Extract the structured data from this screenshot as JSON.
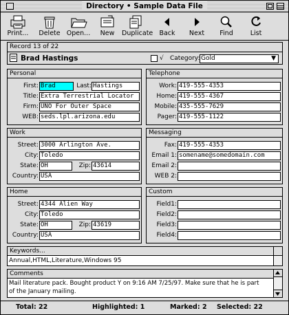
{
  "window": {
    "title": "Directory • Sample Data File"
  },
  "toolbar": [
    {
      "label": "Print...",
      "icon": "printer-icon"
    },
    {
      "label": "Delete",
      "icon": "trash-icon"
    },
    {
      "label": "Open...",
      "icon": "folder-icon"
    },
    {
      "label": "New",
      "icon": "new-record-icon"
    },
    {
      "label": "Duplicate",
      "icon": "duplicate-icon"
    },
    {
      "label": "Back",
      "icon": "back-arrow-icon"
    },
    {
      "label": "Next",
      "icon": "next-arrow-icon"
    },
    {
      "label": "Find",
      "icon": "magnifier-icon"
    },
    {
      "label": "List",
      "icon": "list-icon"
    }
  ],
  "record": {
    "position": "Record 13 of 22",
    "name": "Brad Hastings",
    "checkmark": "√",
    "category_label": "Category:",
    "category_value": "Gold"
  },
  "personal": {
    "title": "Personal",
    "first_label": "First:",
    "first": "Brad",
    "last_label": "Last:",
    "last": "Hastings",
    "title_label": "Title:",
    "title_value": "Extra Terrestrial Locator",
    "firm_label": "Firm:",
    "firm": "UNO For Outer Space",
    "web_label": "WEB:",
    "web": "seds.lpl.arizona.edu"
  },
  "telephone": {
    "title": "Telephone",
    "work_label": "Work:",
    "work": "419-555-4353",
    "home_label": "Home:",
    "home": "419-555-4367",
    "mobile_label": "Mobile:",
    "mobile": "435-555-7629",
    "pager_label": "Pager:",
    "pager": "419-555-1122"
  },
  "work": {
    "title": "Work",
    "street_label": "Street:",
    "street": "3000 Arlington Ave.",
    "city_label": "City:",
    "city": "Toledo",
    "state_label": "State:",
    "state": "OH",
    "zip_label": "Zip:",
    "zip": "43614",
    "country_label": "Country:",
    "country": "USA"
  },
  "messaging": {
    "title": "Messaging",
    "fax_label": "Fax:",
    "fax": "419-555-4353",
    "email1_label": "Email 1:",
    "email1": "somename@somedomain.com",
    "email2_label": "Email 2:",
    "email2": "",
    "web2_label": "WEB 2:",
    "web2": ""
  },
  "home": {
    "title": "Home",
    "street_label": "Street:",
    "street": "4344 Alien Way",
    "city_label": "City:",
    "city": "Toledo",
    "state_label": "State:",
    "state": "OH",
    "zip_label": "Zip:",
    "zip": "43619",
    "country_label": "Country:",
    "country": "USA"
  },
  "custom": {
    "title": "Custom",
    "field1_label": "Field1:",
    "field1": "",
    "field2_label": "Field2:",
    "field2": "",
    "field3_label": "Field3:",
    "field3": "",
    "field4_label": "Field4:",
    "field4": ""
  },
  "keywords": {
    "button_label": "Keywords...",
    "value": "Annual,HTML,Literature,Windows 95"
  },
  "comments": {
    "title": "Comments",
    "line1": "Mail literature pack. Bought product Y on 9:16 AM 7/25/97. Make sure that he is part",
    "line2": "of the January mailing."
  },
  "status": {
    "total": "Total: 22",
    "highlighted": "Highlighted: 1",
    "marked": "Marked: 2",
    "selected": "Selected: 22"
  },
  "colors": {
    "first_field_highlight": "#00ffff",
    "background": "#dddddd"
  }
}
